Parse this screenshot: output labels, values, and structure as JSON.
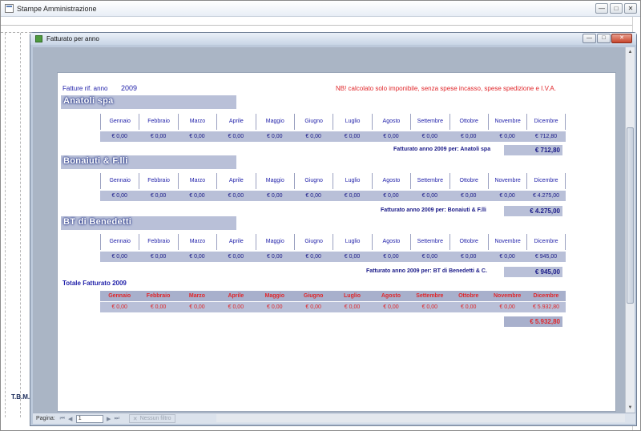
{
  "outer_window": {
    "title": "Stampe Amministrazione",
    "min": "—",
    "max": "□",
    "close": "✕",
    "side_label": "T.B.M."
  },
  "inner_window": {
    "title": "Fatturato per anno",
    "min": "—",
    "max": "□",
    "close": "✕"
  },
  "report": {
    "header_label": "Fatture rif. anno",
    "year": "2009",
    "note": "NB! calcolato solo imponibile, senza spese incasso, spese spedizione e I.V.A.",
    "months": [
      "Gennaio",
      "Febbraio",
      "Marzo",
      "Aprile",
      "Maggio",
      "Giugno",
      "Luglio",
      "Agosto",
      "Settembre",
      "Ottobre",
      "Novembre",
      "Dicembre"
    ],
    "clients": [
      {
        "name": "Anatoli spa",
        "values": [
          "€ 0,00",
          "€ 0,00",
          "€ 0,00",
          "€ 0,00",
          "€ 0,00",
          "€ 0,00",
          "€ 0,00",
          "€ 0,00",
          "€ 0,00",
          "€ 0,00",
          "€ 0,00",
          "€ 712,80"
        ],
        "subtotal_label": "Fatturato anno 2009 per: Anatoli spa",
        "subtotal": "€ 712,80"
      },
      {
        "name": "Bonaiuti & F.lli",
        "values": [
          "€ 0,00",
          "€ 0,00",
          "€ 0,00",
          "€ 0,00",
          "€ 0,00",
          "€ 0,00",
          "€ 0,00",
          "€ 0,00",
          "€ 0,00",
          "€ 0,00",
          "€ 0,00",
          "€ 4.275,00"
        ],
        "subtotal_label": "Fatturato anno 2009 per: Bonaiuti & F.lli",
        "subtotal": "€ 4.275,00"
      },
      {
        "name": "BT di Benedetti",
        "values": [
          "€ 0,00",
          "€ 0,00",
          "€ 0,00",
          "€ 0,00",
          "€ 0,00",
          "€ 0,00",
          "€ 0,00",
          "€ 0,00",
          "€ 0,00",
          "€ 0,00",
          "€ 0,00",
          "€ 945,00"
        ],
        "subtotal_label": "Fatturato anno 2009 per: BT di Benedetti & C.",
        "subtotal": "€ 945,00"
      }
    ],
    "totale_label": "Totale Fatturato 2009",
    "totale_values": [
      "€ 0,00",
      "€ 0,00",
      "€ 0,00",
      "€ 0,00",
      "€ 0,00",
      "€ 0,00",
      "€ 0,00",
      "€ 0,00",
      "€ 0,00",
      "€ 0,00",
      "€ 0,00",
      "€ 5.932,80"
    ],
    "grand_total": "€ 5.932,80"
  },
  "navbar": {
    "page_label": "Pagina:",
    "first": "⏮",
    "prev": "◀",
    "next": "▶",
    "last": "⏭",
    "page_value": "1",
    "filter_label": "Nessun filtro",
    "filter_icon": "✕"
  },
  "colors": {
    "accent_blue": "#2222aa",
    "accent_red": "#e0262a",
    "band": "#b9c0d8"
  }
}
